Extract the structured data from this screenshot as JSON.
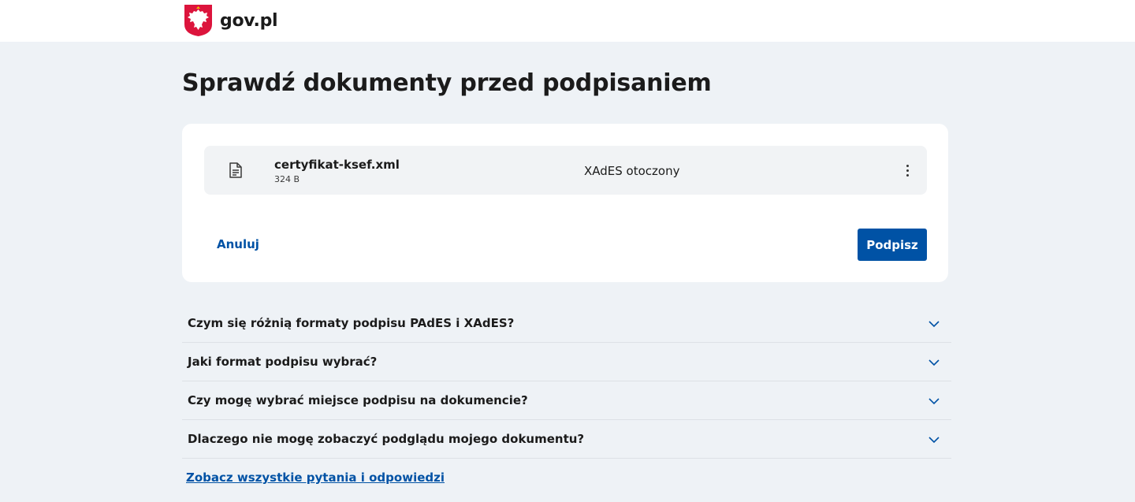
{
  "header": {
    "logo_text": "gov.pl",
    "emblem": "polish-eagle-emblem"
  },
  "page": {
    "title": "Sprawdź dokumenty przed podpisaniem"
  },
  "file": {
    "icon": "document-icon",
    "name": "certyfikat-ksef.xml",
    "size": "324 B",
    "format": "XAdES otoczony",
    "menu_icon": "more-vertical-icon"
  },
  "actions": {
    "cancel_label": "Anuluj",
    "sign_label": "Podpisz"
  },
  "faq": {
    "items": [
      {
        "question": "Czym się różnią formaty podpisu PAdES i XAdES?"
      },
      {
        "question": "Jaki format podpisu wybrać?"
      },
      {
        "question": "Czy mogę wybrać miejsce podpisu na dokumencie?"
      },
      {
        "question": "Dlaczego nie mogę zobaczyć podglądu mojego dokumentu?"
      }
    ],
    "all_link": "Zobacz wszystkie pytania i odpowiedzi"
  },
  "colors": {
    "primary": "#0052a5",
    "background": "#eef2f6",
    "emblem_red": "#dc143c"
  }
}
